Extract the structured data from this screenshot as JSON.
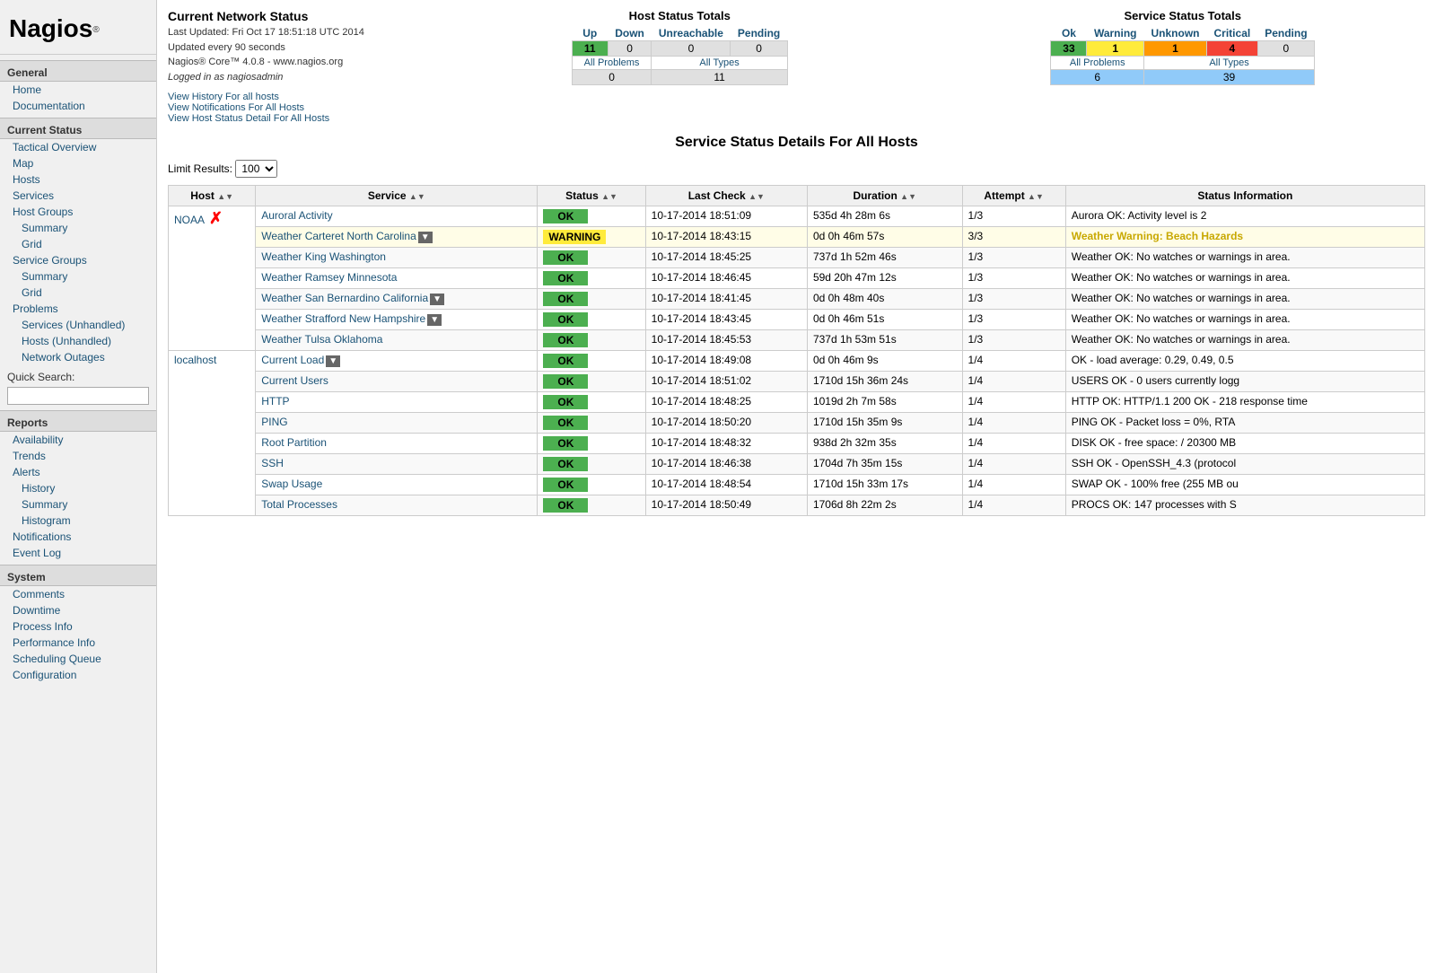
{
  "sidebar": {
    "logo": "Nagios",
    "logo_reg": "®",
    "sections": [
      {
        "header": "General",
        "links": [
          {
            "label": "Home",
            "indent": 1
          },
          {
            "label": "Documentation",
            "indent": 1
          }
        ]
      },
      {
        "header": "Current Status",
        "links": [
          {
            "label": "Tactical Overview",
            "indent": 1
          },
          {
            "label": "Map",
            "indent": 1
          },
          {
            "label": "Hosts",
            "indent": 1
          },
          {
            "label": "Services",
            "indent": 1
          },
          {
            "label": "Host Groups",
            "indent": 1
          },
          {
            "label": "Summary",
            "indent": 2
          },
          {
            "label": "Grid",
            "indent": 2
          },
          {
            "label": "Service Groups",
            "indent": 1
          },
          {
            "label": "Summary",
            "indent": 2
          },
          {
            "label": "Grid",
            "indent": 2
          },
          {
            "label": "Problems",
            "indent": 1
          },
          {
            "label": "Services (Unhandled)",
            "indent": 2
          },
          {
            "label": "Hosts (Unhandled)",
            "indent": 2
          },
          {
            "label": "Network Outages",
            "indent": 2
          }
        ]
      },
      {
        "header": "quick_search",
        "isSearch": true,
        "label": "Quick Search:",
        "placeholder": ""
      },
      {
        "header": "Reports",
        "links": [
          {
            "label": "Availability",
            "indent": 1
          },
          {
            "label": "Trends",
            "indent": 1
          },
          {
            "label": "Alerts",
            "indent": 1
          },
          {
            "label": "History",
            "indent": 2
          },
          {
            "label": "Summary",
            "indent": 2
          },
          {
            "label": "Histogram",
            "indent": 2
          },
          {
            "label": "Notifications",
            "indent": 1
          },
          {
            "label": "Event Log",
            "indent": 1
          }
        ]
      },
      {
        "header": "System",
        "links": [
          {
            "label": "Comments",
            "indent": 1
          },
          {
            "label": "Downtime",
            "indent": 1
          },
          {
            "label": "Process Info",
            "indent": 1
          },
          {
            "label": "Performance Info",
            "indent": 1
          },
          {
            "label": "Scheduling Queue",
            "indent": 1
          },
          {
            "label": "Configuration",
            "indent": 1
          }
        ]
      }
    ]
  },
  "header": {
    "title": "Current Network Status",
    "last_updated": "Last Updated: Fri Oct 17 18:51:18 UTC 2014",
    "update_interval": "Updated every 90 seconds",
    "version": "Nagios® Core™ 4.0.8 - www.nagios.org",
    "logged_in": "Logged in as nagiosadmin",
    "view_history": "View History For all hosts",
    "view_notifications": "View Notifications For All Hosts",
    "view_detail": "View Host Status Detail For All Hosts"
  },
  "host_status_totals": {
    "title": "Host Status Totals",
    "headers": [
      "Up",
      "Down",
      "Unreachable",
      "Pending"
    ],
    "values": [
      "11",
      "0",
      "0",
      "0"
    ],
    "all_problems_label": "All Problems",
    "all_types_label": "All Types",
    "all_problems_value": "0",
    "all_types_value": "11"
  },
  "service_status_totals": {
    "title": "Service Status Totals",
    "headers": [
      "Ok",
      "Warning",
      "Unknown",
      "Critical",
      "Pending"
    ],
    "values": [
      "33",
      "1",
      "1",
      "4",
      "0"
    ],
    "all_problems_label": "All Problems",
    "all_types_label": "All Types",
    "all_problems_value": "6",
    "all_types_value": "39"
  },
  "page_title": "Service Status Details For All Hosts",
  "limit_results": {
    "label": "Limit Results:",
    "value": "100"
  },
  "table": {
    "columns": [
      {
        "label": "Host",
        "sortable": true
      },
      {
        "label": "Service",
        "sortable": true
      },
      {
        "label": "Status",
        "sortable": true
      },
      {
        "label": "Last Check",
        "sortable": true
      },
      {
        "label": "Duration",
        "sortable": true
      },
      {
        "label": "Attempt",
        "sortable": true
      },
      {
        "label": "Status Information",
        "sortable": false
      }
    ],
    "rows": [
      {
        "host": "NOAA",
        "host_show_x": true,
        "host_rowspan": 7,
        "service": "Auroral Activity",
        "status": "OK",
        "status_type": "ok",
        "last_check": "10-17-2014 18:51:09",
        "duration": "535d 4h 28m 6s",
        "attempt": "1/3",
        "info": "Aurora OK: Activity level is 2",
        "row_class": "row-normal"
      },
      {
        "host": "",
        "service": "Weather Carteret North Carolina",
        "has_action": true,
        "status": "WARNING",
        "status_type": "warning",
        "last_check": "10-17-2014 18:43:15",
        "duration": "0d 0h 46m 57s",
        "attempt": "3/3",
        "info": "Weather Warning: Beach Hazards",
        "row_class": "row-warning"
      },
      {
        "host": "",
        "service": "Weather King Washington",
        "status": "OK",
        "status_type": "ok",
        "last_check": "10-17-2014 18:45:25",
        "duration": "737d 1h 52m 46s",
        "attempt": "1/3",
        "info": "Weather OK: No watches or warnings in area.",
        "row_class": "row-alt"
      },
      {
        "host": "",
        "service": "Weather Ramsey Minnesota",
        "status": "OK",
        "status_type": "ok",
        "last_check": "10-17-2014 18:46:45",
        "duration": "59d 20h 47m 12s",
        "attempt": "1/3",
        "info": "Weather OK: No watches or warnings in area.",
        "row_class": "row-normal"
      },
      {
        "host": "",
        "service": "Weather San Bernardino California",
        "has_action": true,
        "status": "OK",
        "status_type": "ok",
        "last_check": "10-17-2014 18:41:45",
        "duration": "0d 0h 48m 40s",
        "attempt": "1/3",
        "info": "Weather OK: No watches or warnings in area.",
        "row_class": "row-alt"
      },
      {
        "host": "",
        "service": "Weather Strafford New Hampshire",
        "has_action": true,
        "status": "OK",
        "status_type": "ok",
        "last_check": "10-17-2014 18:43:45",
        "duration": "0d 0h 46m 51s",
        "attempt": "1/3",
        "info": "Weather OK: No watches or warnings in area.",
        "row_class": "row-normal"
      },
      {
        "host": "",
        "service": "Weather Tulsa Oklahoma",
        "status": "OK",
        "status_type": "ok",
        "last_check": "10-17-2014 18:45:53",
        "duration": "737d 1h 53m 51s",
        "attempt": "1/3",
        "info": "Weather OK: No watches or warnings in area.",
        "row_class": "row-alt"
      },
      {
        "host": "localhost",
        "host_rowspan": 8,
        "service": "Current Load",
        "has_action": true,
        "status": "OK",
        "status_type": "ok",
        "last_check": "10-17-2014 18:49:08",
        "duration": "0d 0h 46m 9s",
        "attempt": "1/4",
        "info": "OK - load average: 0.29, 0.49, 0.5",
        "row_class": "row-normal"
      },
      {
        "host": "",
        "service": "Current Users",
        "status": "OK",
        "status_type": "ok",
        "last_check": "10-17-2014 18:51:02",
        "duration": "1710d 15h 36m 24s",
        "attempt": "1/4",
        "info": "USERS OK - 0 users currently logg",
        "row_class": "row-alt"
      },
      {
        "host": "",
        "service": "HTTP",
        "status": "OK",
        "status_type": "ok",
        "last_check": "10-17-2014 18:48:25",
        "duration": "1019d 2h 7m 58s",
        "attempt": "1/4",
        "info": "HTTP OK: HTTP/1.1 200 OK - 218 response time",
        "row_class": "row-normal"
      },
      {
        "host": "",
        "service": "PING",
        "status": "OK",
        "status_type": "ok",
        "last_check": "10-17-2014 18:50:20",
        "duration": "1710d 15h 35m 9s",
        "attempt": "1/4",
        "info": "PING OK - Packet loss = 0%, RTA",
        "row_class": "row-alt"
      },
      {
        "host": "",
        "service": "Root Partition",
        "status": "OK",
        "status_type": "ok",
        "last_check": "10-17-2014 18:48:32",
        "duration": "938d 2h 32m 35s",
        "attempt": "1/4",
        "info": "DISK OK - free space: / 20300 MB",
        "row_class": "row-normal"
      },
      {
        "host": "",
        "service": "SSH",
        "status": "OK",
        "status_type": "ok",
        "last_check": "10-17-2014 18:46:38",
        "duration": "1704d 7h 35m 15s",
        "attempt": "1/4",
        "info": "SSH OK - OpenSSH_4.3 (protocol",
        "row_class": "row-alt"
      },
      {
        "host": "",
        "service": "Swap Usage",
        "status": "OK",
        "status_type": "ok",
        "last_check": "10-17-2014 18:48:54",
        "duration": "1710d 15h 33m 17s",
        "attempt": "1/4",
        "info": "SWAP OK - 100% free (255 MB ou",
        "row_class": "row-normal"
      },
      {
        "host": "",
        "service": "Total Processes",
        "status": "OK",
        "status_type": "ok",
        "last_check": "10-17-2014 18:50:49",
        "duration": "1706d 8h 22m 2s",
        "attempt": "1/4",
        "info": "PROCS OK: 147 processes with S",
        "row_class": "row-alt"
      }
    ]
  }
}
